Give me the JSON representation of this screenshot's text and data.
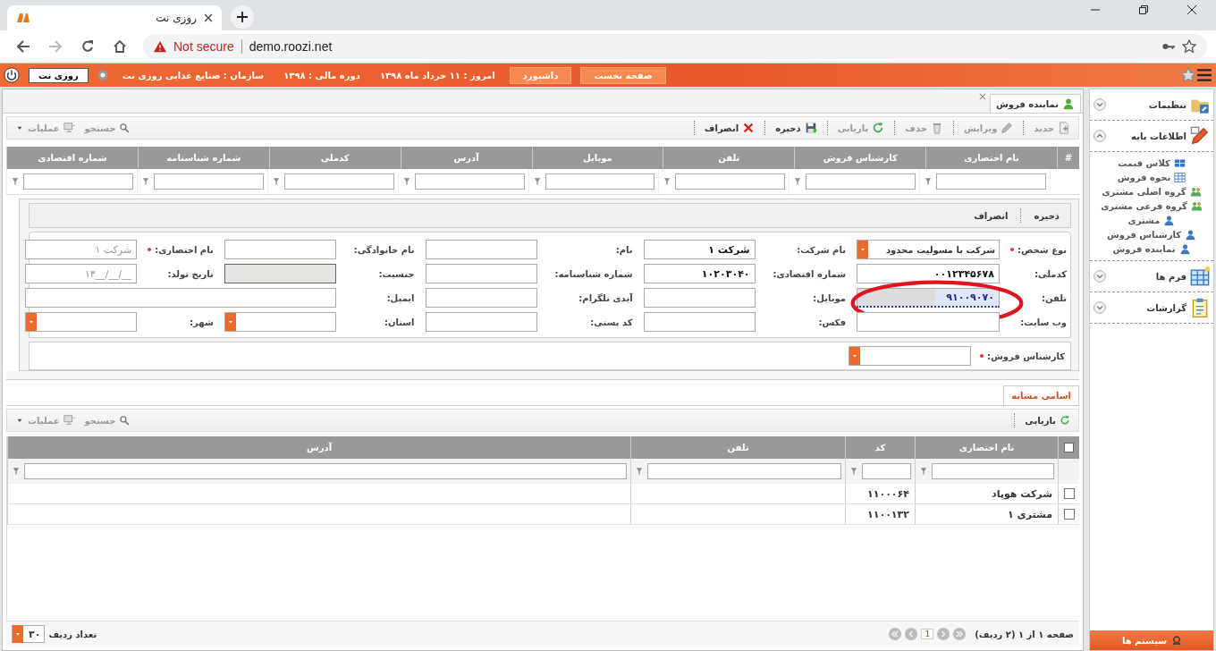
{
  "browser": {
    "tab_title": "روزی نت",
    "security": "Not secure",
    "url": "demo.roozi.net"
  },
  "header": {
    "user_button": "روزی نت",
    "info": [
      "امروز : ۱۱ خرداد ماه ۱۳۹۸",
      "دوره مالی : ۱۳۹۸",
      "سازمان : صنایع غذایی روزی نت"
    ],
    "nav_buttons": [
      "صفحه نخست",
      "داشبورد"
    ]
  },
  "document_tab": {
    "label": "نماینده فروش"
  },
  "toolbar": {
    "actions": [
      {
        "kind": "new",
        "label": "جدید",
        "disabled": true
      },
      {
        "kind": "edit",
        "label": "ویرایش",
        "disabled": true
      },
      {
        "kind": "delete",
        "label": "حذف",
        "disabled": true
      },
      {
        "kind": "refresh",
        "label": "بازیابی",
        "disabled": true
      },
      {
        "kind": "save",
        "label": "ذخیره",
        "disabled": false
      },
      {
        "kind": "cancel",
        "label": "انصراف",
        "disabled": false
      }
    ],
    "search": "جستجو",
    "operations": "عملیات"
  },
  "grid": {
    "row_number_header": "#",
    "columns": [
      "نام اختصاری",
      "کارشناس فروش",
      "تلفن",
      "موبایل",
      "آدرس",
      "کدملی",
      "شماره شناسنامه",
      "شماره اقتصادی"
    ]
  },
  "form": {
    "actions": [
      "ذخیره",
      "انصراف"
    ],
    "rows": [
      [
        {
          "kind": "select",
          "label": "نوع شخص:",
          "required": true,
          "value": "شرکت با مسولیت محدود",
          "disabled": false,
          "focused": false,
          "circled": false
        },
        {
          "kind": "text",
          "label": "نام شرکت:",
          "required": false,
          "value": "شرکت ۱",
          "disabled": false,
          "focused": false,
          "circled": false
        },
        {
          "kind": "text",
          "label": "نام:",
          "required": false,
          "disabled": false,
          "focused": false,
          "circled": false
        },
        {
          "kind": "text",
          "label": "نام خانوادگی:",
          "required": false,
          "disabled": false,
          "focused": false,
          "circled": false
        },
        {
          "kind": "text",
          "label": "نام اختصاری:",
          "required": true,
          "placeholder": "شرکت ۱",
          "disabled": false,
          "focused": false,
          "circled": false
        }
      ],
      [
        {
          "kind": "text",
          "label": "کدملی:",
          "required": false,
          "value": "۰۰۱۲۳۴۵۶۷۸",
          "disabled": false,
          "focused": false,
          "circled": false
        },
        {
          "kind": "text",
          "label": "شماره اقتصادی:",
          "required": false,
          "value": "۱۰۲۰۳۰۴۰",
          "disabled": false,
          "focused": false,
          "circled": false
        },
        {
          "kind": "text",
          "label": "شماره شناسنامه:",
          "required": false,
          "disabled": false,
          "focused": false,
          "circled": false
        },
        {
          "kind": "text",
          "label": "جنسیت:",
          "required": false,
          "disabled": true,
          "focused": false,
          "circled": false
        },
        {
          "kind": "date",
          "label": "تاریخ تولد:",
          "required": false,
          "placeholder": "۱۳__/__/__",
          "disabled": false,
          "focused": false,
          "circled": false
        }
      ],
      [
        {
          "kind": "text",
          "label": "تلفن:",
          "required": false,
          "value": "۹۱۰۰۹۰۷۰",
          "disabled": false,
          "focused": true,
          "circled": true
        },
        {
          "kind": "text",
          "label": "موبایل:",
          "required": false,
          "disabled": false,
          "focused": false,
          "circled": false
        },
        {
          "kind": "text",
          "label": "آیدی تلگرام:",
          "required": false,
          "disabled": false,
          "focused": false,
          "circled": false
        },
        {
          "kind": "wide",
          "label": "ایمیل:",
          "required": false,
          "disabled": false,
          "focused": false,
          "circled": false
        }
      ],
      [
        {
          "kind": "text",
          "label": "وب سایت:",
          "required": false,
          "disabled": false,
          "focused": false,
          "circled": false
        },
        {
          "kind": "text",
          "label": "فکس:",
          "required": false,
          "disabled": false,
          "focused": false,
          "circled": false
        },
        {
          "kind": "text",
          "label": "کد پستی:",
          "required": false,
          "disabled": false,
          "focused": false,
          "circled": false
        },
        {
          "kind": "select",
          "label": "استان:",
          "required": false,
          "disabled": false,
          "focused": false,
          "circled": false
        },
        {
          "kind": "select",
          "label": "شهر:",
          "required": false,
          "disabled": false,
          "focused": false,
          "circled": false
        }
      ]
    ],
    "sales_expert": {
      "label": "کارشناس فروش:",
      "required": true
    }
  },
  "similar": {
    "all_checked": false,
    "tabs": [
      {
        "label": "اسامی مشابه",
        "selected": true
      }
    ],
    "refresh": "بازیابی",
    "search": "جستجو",
    "operations": "عملیات",
    "columns": [
      "نام اختصاری",
      "کد",
      "تلفن",
      "آدرس"
    ],
    "rows": [
      {
        "checked": false,
        "cells": [
          "شرکت هوپاد",
          "۱۱۰۰۰۶۴",
          "",
          ""
        ]
      },
      {
        "checked": false,
        "cells": [
          "مشتری ۱",
          "۱۱۰۰۱۳۲",
          "",
          ""
        ]
      }
    ]
  },
  "pager": {
    "summary": "صفحه ۱ از ۱ (۲ ردیف)",
    "page": "1",
    "rows_label": "تعداد ردیف",
    "rows_value": "۳۰"
  },
  "sidebar": {
    "sections": [
      {
        "kind": "settings",
        "label": "تنظیمات",
        "expanded": false
      },
      {
        "kind": "base",
        "label": "اطلاعات پایه",
        "expanded": true,
        "items": [
          {
            "kind": "grid",
            "label": "کلاس قیمت"
          },
          {
            "kind": "table",
            "label": "نحوه فروش"
          },
          {
            "kind": "group",
            "label": "گروه اصلی مشتری"
          },
          {
            "kind": "group",
            "label": "گروه فرعی مشتری"
          },
          {
            "kind": "person",
            "label": "مشتری"
          },
          {
            "kind": "person",
            "label": "کارشناس فروش"
          },
          {
            "kind": "person",
            "label": "نماینده فروش"
          }
        ]
      },
      {
        "kind": "forms",
        "label": "فرم ها",
        "expanded": false
      },
      {
        "kind": "reports",
        "label": "گزارشات",
        "expanded": false
      }
    ],
    "systems_button": "سیستم ها"
  }
}
